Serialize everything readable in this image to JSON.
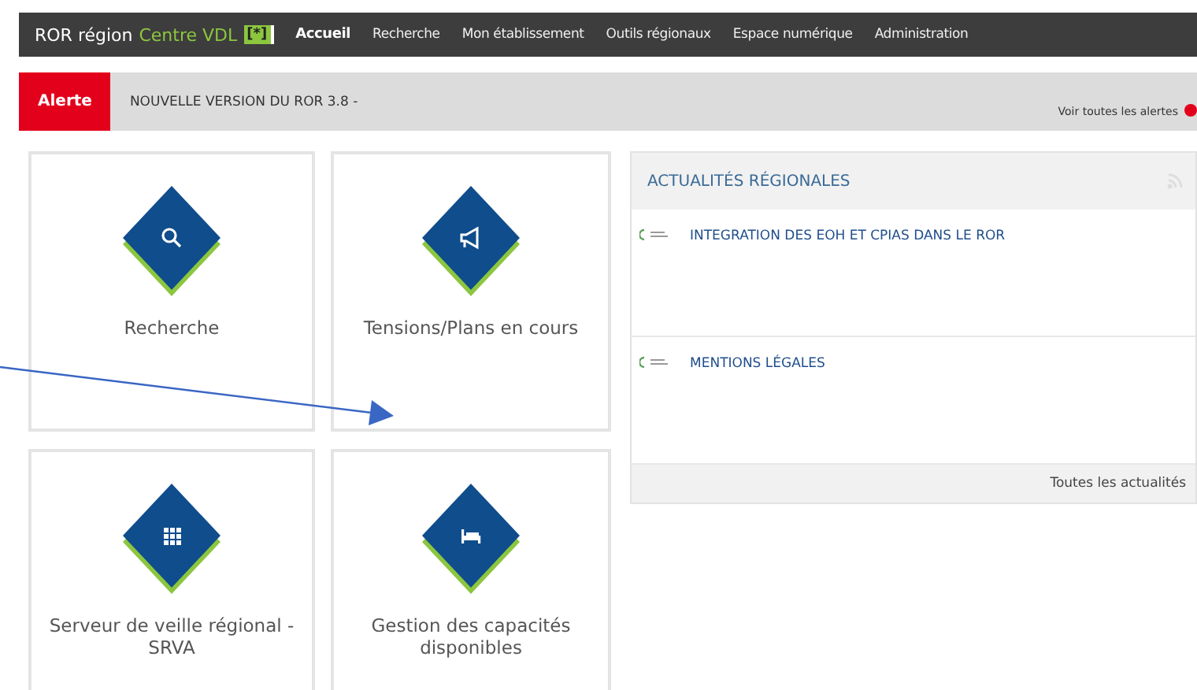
{
  "navbar": {
    "brand": "ROR région",
    "region": "Centre VDL",
    "brand_badge": "[*]",
    "items": [
      {
        "label": "Accueil",
        "selected": true
      },
      {
        "label": "Recherche",
        "selected": false
      },
      {
        "label": "Mon établissement",
        "selected": false
      },
      {
        "label": "Outils régionaux",
        "selected": false
      },
      {
        "label": "Espace numérique",
        "selected": false
      },
      {
        "label": "Administration",
        "selected": false
      }
    ]
  },
  "alert": {
    "tag": "Alerte",
    "message": "NOUVELLE VERSION DU ROR 3.8 -",
    "link": "Voir toutes les alertes"
  },
  "tiles": [
    {
      "kind": "search",
      "label": "Recherche"
    },
    {
      "kind": "megaphone",
      "label": "Tensions/Plans en cours"
    },
    {
      "kind": "grid",
      "label": "Serveur de veille régional - SRVA"
    },
    {
      "kind": "bed",
      "label": "Gestion des capacités disponibles"
    }
  ],
  "news": {
    "title": "ACTUALITÉS RÉGIONALES",
    "items": [
      "INTEGRATION DES EOH ET CPIAS DANS LE ROR",
      "MENTIONS LÉGALES"
    ],
    "footer_link": "Toutes les actualités"
  }
}
